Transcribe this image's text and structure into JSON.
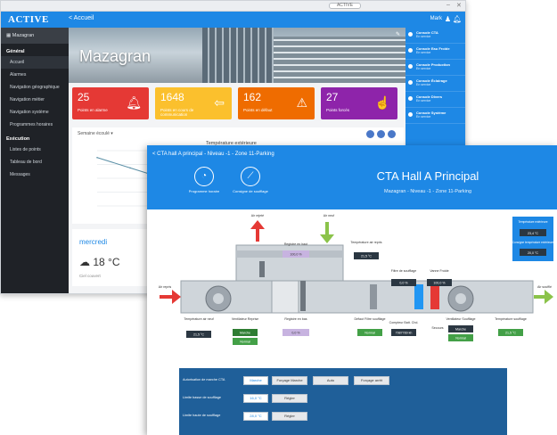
{
  "back_window": {
    "urlbar": "ACTIVE",
    "brand": "ACTIVE",
    "back_label": "< Accueil",
    "user_label": "Mark",
    "site_name": "Mazagran",
    "sidebar": {
      "section1": "Général",
      "items1": [
        "Accueil",
        "Alarmes",
        "Navigation géographique",
        "Navigation métier",
        "Navigation système",
        "Programmes horaires"
      ],
      "section2": "Exécution",
      "items2": [
        "Listes de points",
        "Tableau de bord",
        "Messages"
      ]
    },
    "banner_title": "Mazagran",
    "tiles": [
      {
        "value": "25",
        "label": "Points en alarme",
        "color": "#e53935"
      },
      {
        "value": "1648",
        "label": "Points en cours de communication",
        "color": "#fbc02d"
      },
      {
        "value": "162",
        "label": "Points en défaut",
        "color": "#ef6c00"
      },
      {
        "value": "27",
        "label": "Points forcés",
        "color": "#8e24aa"
      }
    ],
    "chart_selector": "Semaine écoulé",
    "chart_title": "Température extérieure",
    "chart_data": {
      "type": "line",
      "title": "Température extérieure",
      "values": [
        14,
        11,
        8,
        6,
        5,
        5,
        6,
        7,
        7,
        8
      ]
    },
    "weather": {
      "day": "mercredi",
      "temp": "18 °C",
      "condition": "Ciel couvert"
    },
    "right_panel": [
      {
        "title": "Console CTA",
        "sub": "En service"
      },
      {
        "title": "Console Eau Froide",
        "sub": "En service"
      },
      {
        "title": "Console Production",
        "sub": "En service"
      },
      {
        "title": "Console Éclairage",
        "sub": "En service"
      },
      {
        "title": "Console Divers",
        "sub": "En service"
      },
      {
        "title": "Console Système",
        "sub": "En service"
      }
    ]
  },
  "front_window": {
    "breadcrumb": "< CTA hall A principal - Niveau -1 - Zone 11-Parking",
    "title": "CTA Hall A Principal",
    "subtitle": "Mazagran - Niveau -1 - Zone 11-Parking",
    "btn_program": "Programme horaire",
    "btn_setpoints": "Consigne de soufflage",
    "diagram": {
      "air_rejete": "Air rejeté",
      "air_neuf": "Air neuf",
      "air_repris": "Air repris",
      "air_souffle": "Air soufflé",
      "registre_haut": "Registre en haut",
      "registre_haut_val": "100,0 %",
      "temp_reprise": "Température air repris",
      "temp_reprise_val": "21,5 °C",
      "registre_bas": "Registre en bas",
      "registre_bas_val": "0,0 %",
      "temp_neuf": "Température air neuf",
      "temp_neuf_val": "21,5 °C",
      "vent_reprise": "Ventilateur Reprise",
      "vent_reprise_state": "Marche",
      "vent_reprise_mode": "Normal",
      "defaut_filtre": "Défaut Filtre soufflage",
      "defaut_filtre_state": "Normal",
      "filtre_soufflage": "Filtre de soufflage",
      "filtre_soufflage_val": "0,0 %",
      "vanne_froide": "Vanne Froide",
      "vanne_froide_val": "100,0 %",
      "compteur": "Compteur Batt. Chd.",
      "compteur_val": "7987789 kh",
      "vent_soufflage": "Ventilateur Soufflage",
      "vent_soufflage_state": "Marche",
      "vent_soufflage_mode": "Normal",
      "temp_soufflage": "Température soufflage",
      "temp_soufflage_val": "21,5 °C",
      "secours": "Secours",
      "right_box_t1": "Température extérieure",
      "right_box_v1": "23,4 °C",
      "right_box_t2": "Consigne température extérieure",
      "right_box_v2": "20,0 °C"
    },
    "controls": {
      "row1_label": "Autorisation de marche CTA",
      "row1_value": "Marche",
      "row1_b1": "Forçage Marche",
      "row1_b2": "Auto",
      "row1_b3": "Forçage arrêt",
      "row2_label": "Limite basse de soufflage",
      "row2_value": "16,0 °C",
      "row2_btn": "Régler",
      "row3_label": "Limite haute de soufflage",
      "row3_value": "28,0 °C",
      "row3_btn": "Régler"
    }
  }
}
